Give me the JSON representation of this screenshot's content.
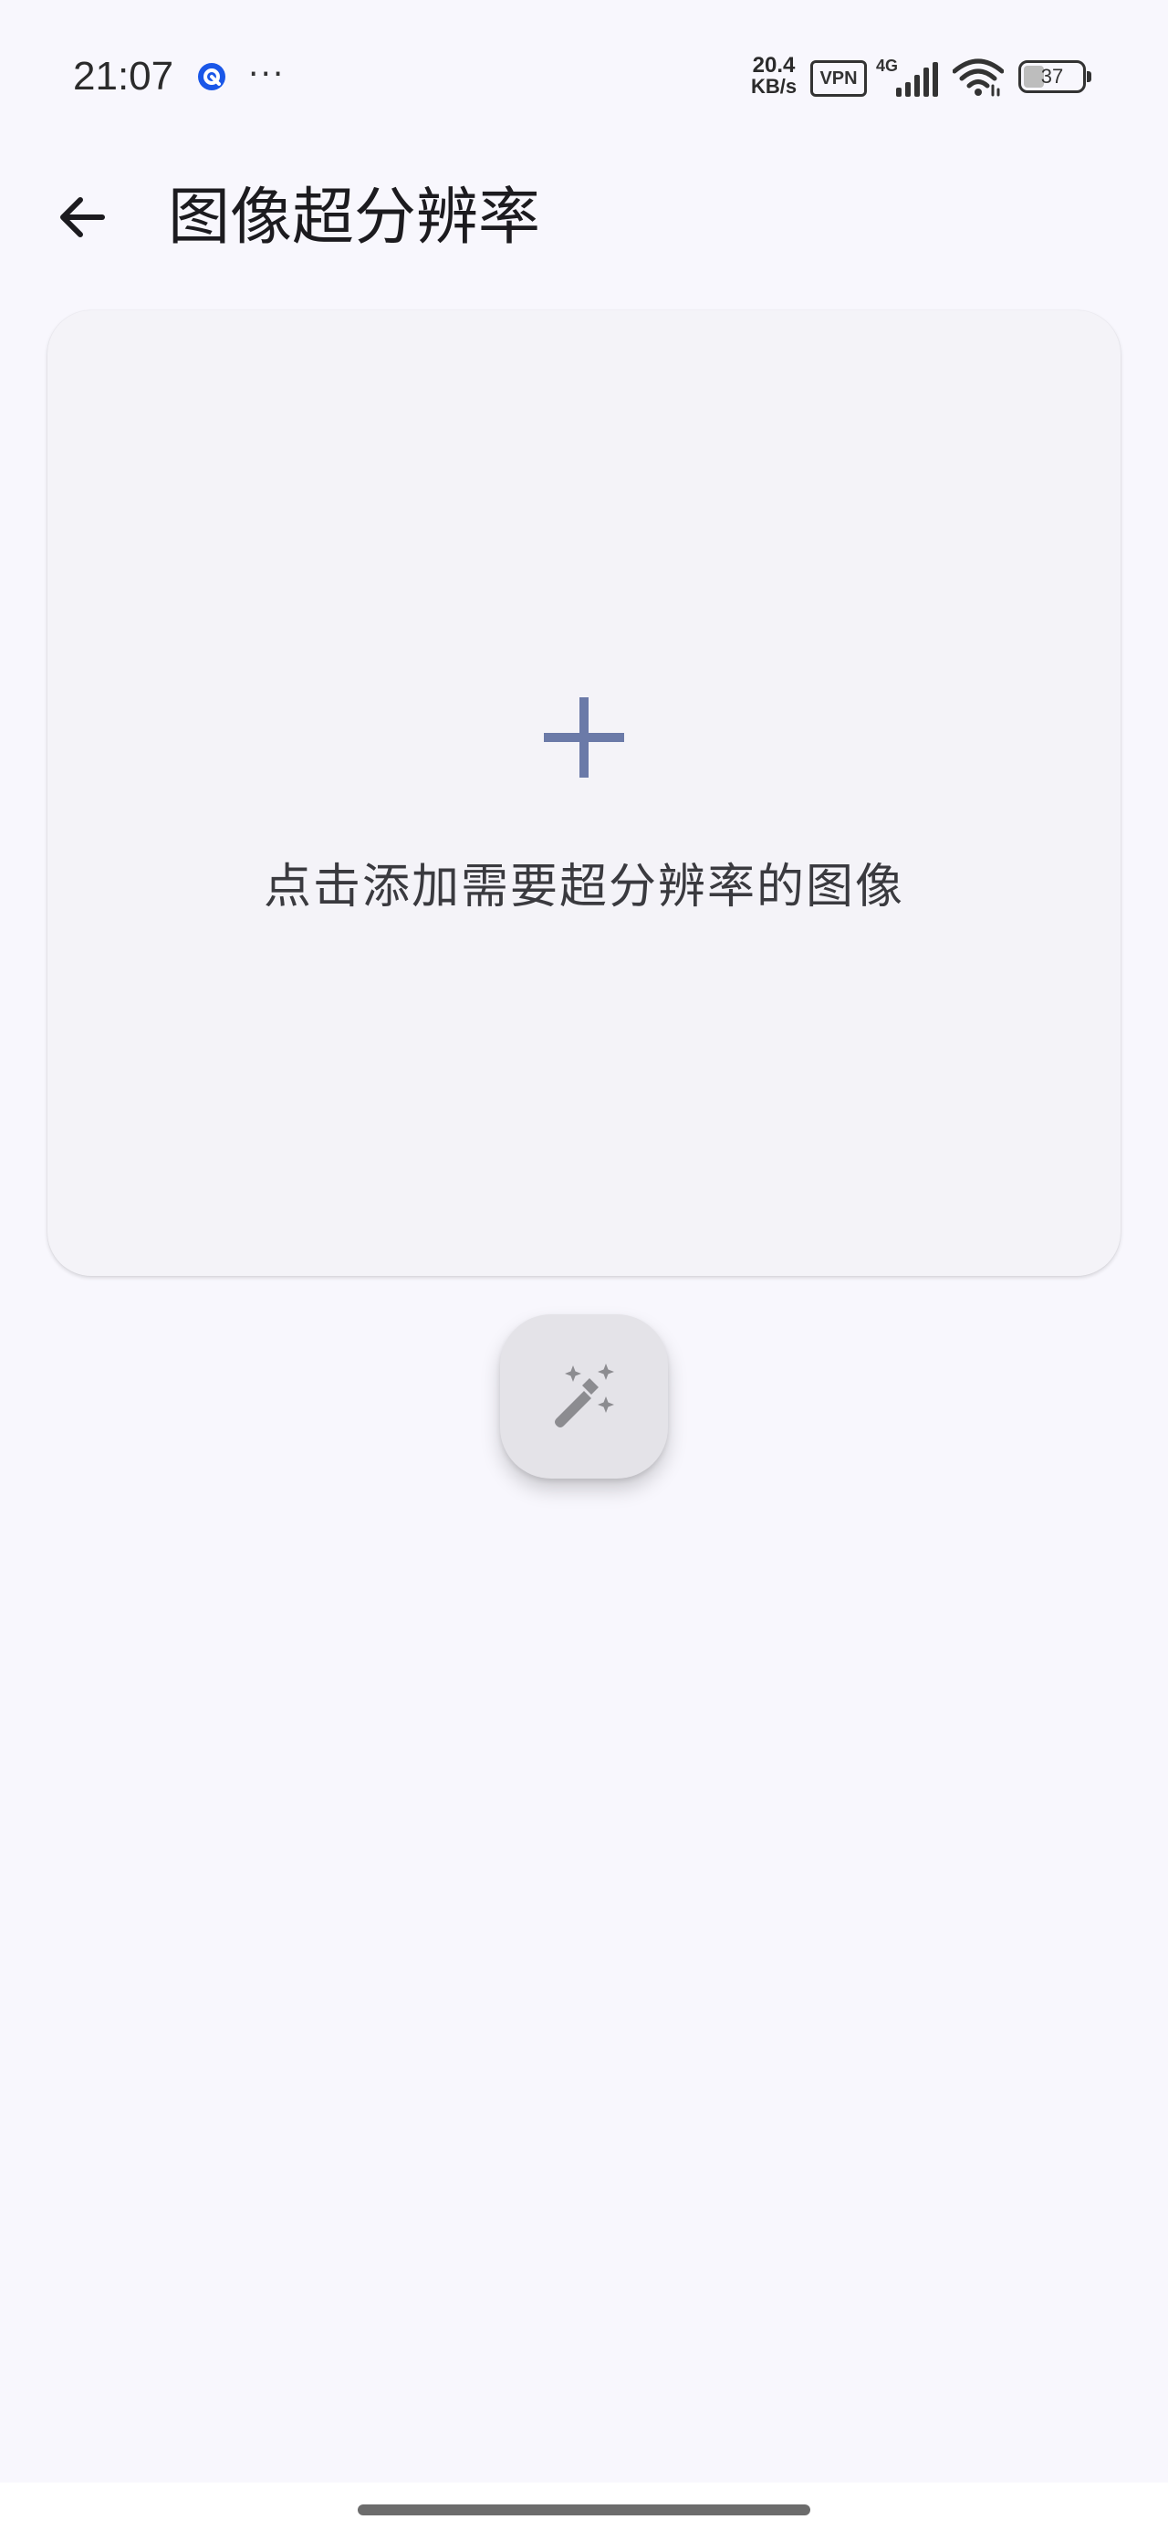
{
  "status_bar": {
    "time": "21:07",
    "net_speed_value": "20.4",
    "net_speed_unit": "KB/s",
    "vpn_label": "VPN",
    "network_type": "4G",
    "battery_level": "37",
    "icons": [
      "app-notification-icon",
      "more-dots-icon",
      "signal-icon",
      "wifi-icon",
      "battery-icon"
    ]
  },
  "app_bar": {
    "back_icon": "arrow-back-icon",
    "title": "图像超分辨率"
  },
  "upload_card": {
    "icon": "add-icon",
    "hint": "点击添加需要超分辨率的图像",
    "icon_color": "#6b7aa8"
  },
  "fab": {
    "icon": "magic-wand-icon",
    "icon_color": "#8c8c90"
  },
  "colors": {
    "background": "#f8f7fd",
    "card": "#f4f3f8",
    "fab": "#e4e3e8",
    "accent_blue": "#1a57e8"
  }
}
